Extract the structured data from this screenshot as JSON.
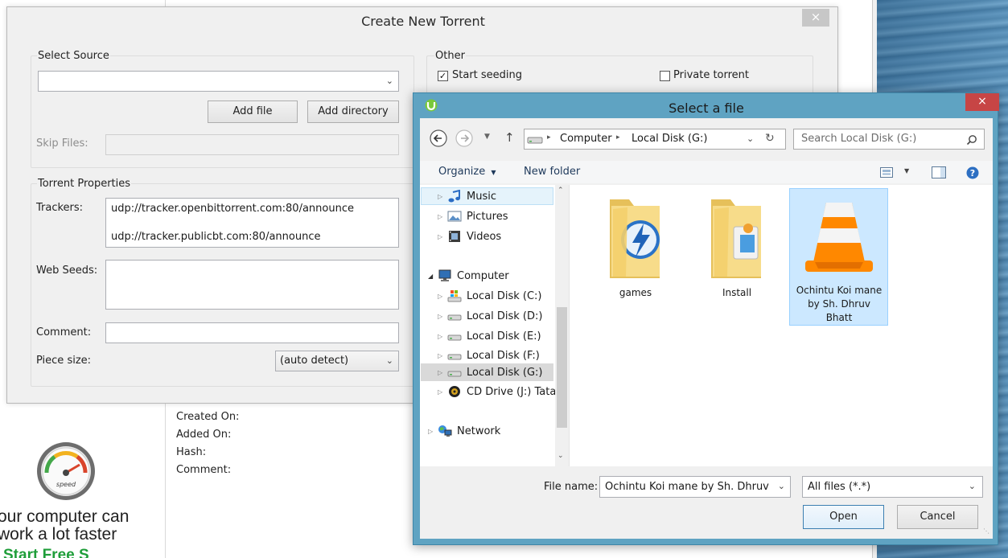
{
  "background_app": {
    "info_labels": [
      "Created On:",
      "Added On:",
      "Hash:",
      "Comment:"
    ],
    "ad_text_line1": "our computer can",
    "ad_text_line2": "work a lot faster",
    "ad_cta": "Start Free S",
    "speed_icon_label": "speed"
  },
  "torrent_dialog": {
    "title": "Create New Torrent",
    "close_label": "×",
    "select_source": {
      "label": "Select Source",
      "value": "",
      "add_file": "Add file",
      "add_directory": "Add directory",
      "skip_files_label": "Skip Files:"
    },
    "other": {
      "label": "Other",
      "start_seeding_label": "Start seeding",
      "start_seeding_checked": true,
      "private_torrent_label": "Private torrent",
      "private_torrent_checked": false
    },
    "torrent_properties": {
      "label": "Torrent Properties",
      "trackers_label": "Trackers:",
      "trackers": [
        "udp://tracker.openbittorrent.com:80/announce",
        "udp://tracker.publicbt.com:80/announce"
      ],
      "web_seeds_label": "Web Seeds:",
      "comment_label": "Comment:",
      "piece_size_label": "Piece size:",
      "piece_size_value": "(auto detect)"
    }
  },
  "file_dialog": {
    "title": "Select a file",
    "close_label": "×",
    "breadcrumb": [
      "Computer",
      "Local Disk (G:)"
    ],
    "search_placeholder": "Search Local Disk (G:)",
    "toolbar": {
      "organize": "Organize",
      "new_folder": "New folder"
    },
    "nav_items": [
      {
        "label": "Music",
        "icon": "music-icon"
      },
      {
        "label": "Pictures",
        "icon": "pictures-icon"
      },
      {
        "label": "Videos",
        "icon": "videos-icon"
      },
      {
        "label": "Computer",
        "icon": "computer-icon"
      },
      {
        "label": "Local Disk (C:)",
        "icon": "drive-icon"
      },
      {
        "label": "Local Disk (D:)",
        "icon": "drive-icon"
      },
      {
        "label": "Local Disk (E:)",
        "icon": "drive-icon"
      },
      {
        "label": "Local Disk (F:)",
        "icon": "drive-icon"
      },
      {
        "label": "Local Disk (G:)",
        "icon": "drive-icon"
      },
      {
        "label": "CD Drive (J:) Tata",
        "icon": "cd-drive-icon"
      },
      {
        "label": "Network",
        "icon": "network-icon"
      }
    ],
    "files": [
      {
        "name": "games",
        "icon": "folder-icon"
      },
      {
        "name": "Install",
        "icon": "folder-icon"
      },
      {
        "name": "Ochintu Koi mane by Sh. Dhruv Bhatt",
        "icon": "vlc-file-icon"
      }
    ],
    "file_name_label": "File name:",
    "file_name_value": "Ochintu Koi mane by Sh. Dhruv Bh",
    "file_type_value": "All files (*.*)",
    "open_button": "Open",
    "cancel_button": "Cancel"
  },
  "colors": {
    "dialog_frame": "#5fa3c2",
    "close_red": "#c74545",
    "selection_blue": "#cce8ff",
    "cta_green": "#1f9e3a"
  }
}
